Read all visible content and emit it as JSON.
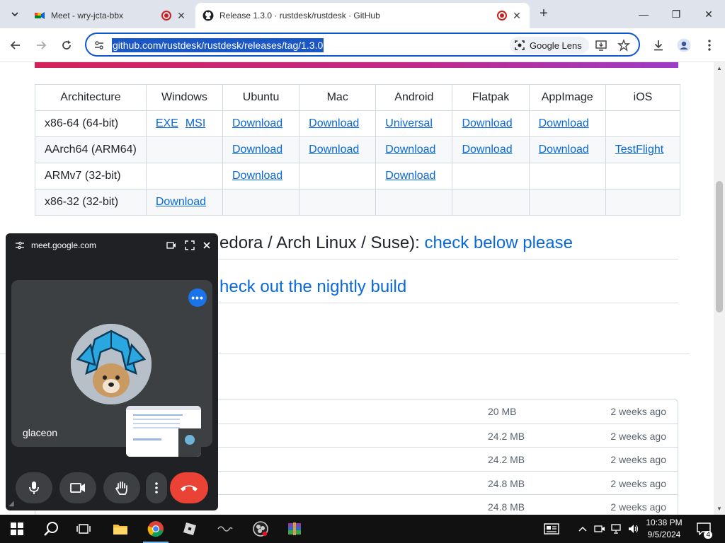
{
  "browser": {
    "tabs": [
      {
        "title": "Meet - wry-jcta-bbx",
        "favicon": "google-meet-icon",
        "recording": true
      },
      {
        "title": "Release 1.3.0 · rustdesk/rustdesk · GitHub",
        "favicon": "github-icon",
        "recording": true
      }
    ],
    "url": "github.com/rustdesk/rustdesk/releases/tag/1.3.0",
    "lens_label": "Google Lens"
  },
  "release_table": {
    "headers": [
      "Architecture",
      "Windows",
      "Ubuntu",
      "Mac",
      "Android",
      "Flatpak",
      "AppImage",
      "iOS"
    ],
    "rows": [
      {
        "arch": "x86-64 (64-bit)",
        "windows": [
          "EXE",
          "MSI"
        ],
        "ubuntu": "Download",
        "mac": "Download",
        "android": "Universal",
        "flatpak": "Download",
        "appimage": "Download",
        "ios": ""
      },
      {
        "arch": "AArch64 (ARM64)",
        "windows": [],
        "ubuntu": "Download",
        "mac": "Download",
        "android": "Download",
        "flatpak": "Download",
        "appimage": "Download",
        "ios": "TestFlight"
      },
      {
        "arch": "ARMv7 (32-bit)",
        "windows": [],
        "ubuntu": "Download",
        "mac": "",
        "android": "Download",
        "flatpak": "",
        "appimage": "",
        "ios": ""
      },
      {
        "arch": "x86-32 (32-bit)",
        "windows": [
          "Download"
        ],
        "ubuntu": "",
        "mac": "",
        "android": "",
        "flatpak": "",
        "appimage": "",
        "ios": ""
      }
    ]
  },
  "sections": {
    "linux_heading_text": "edora / Arch Linux / Suse): ",
    "linux_heading_link": "check below please",
    "nightly_heading_link": "heck out the nightly build"
  },
  "assets": [
    {
      "size": "20 MB",
      "date": "2 weeks ago"
    },
    {
      "size": "24.2 MB",
      "date": "2 weeks ago"
    },
    {
      "size": "24.2 MB",
      "date": "2 weeks ago"
    },
    {
      "size": "24.8 MB",
      "date": "2 weeks ago"
    },
    {
      "size": "24.8 MB",
      "date": "2 weeks ago"
    }
  ],
  "meet_pip": {
    "site": "meet.google.com",
    "participant_name": "glaceon"
  },
  "taskbar": {
    "time": "10:38 PM",
    "date": "9/5/2024",
    "notification_count": "4"
  },
  "colors": {
    "link": "#0969da",
    "url_highlight": "#1a56c4",
    "end_call": "#ea4335",
    "meet_bg": "#202124"
  }
}
